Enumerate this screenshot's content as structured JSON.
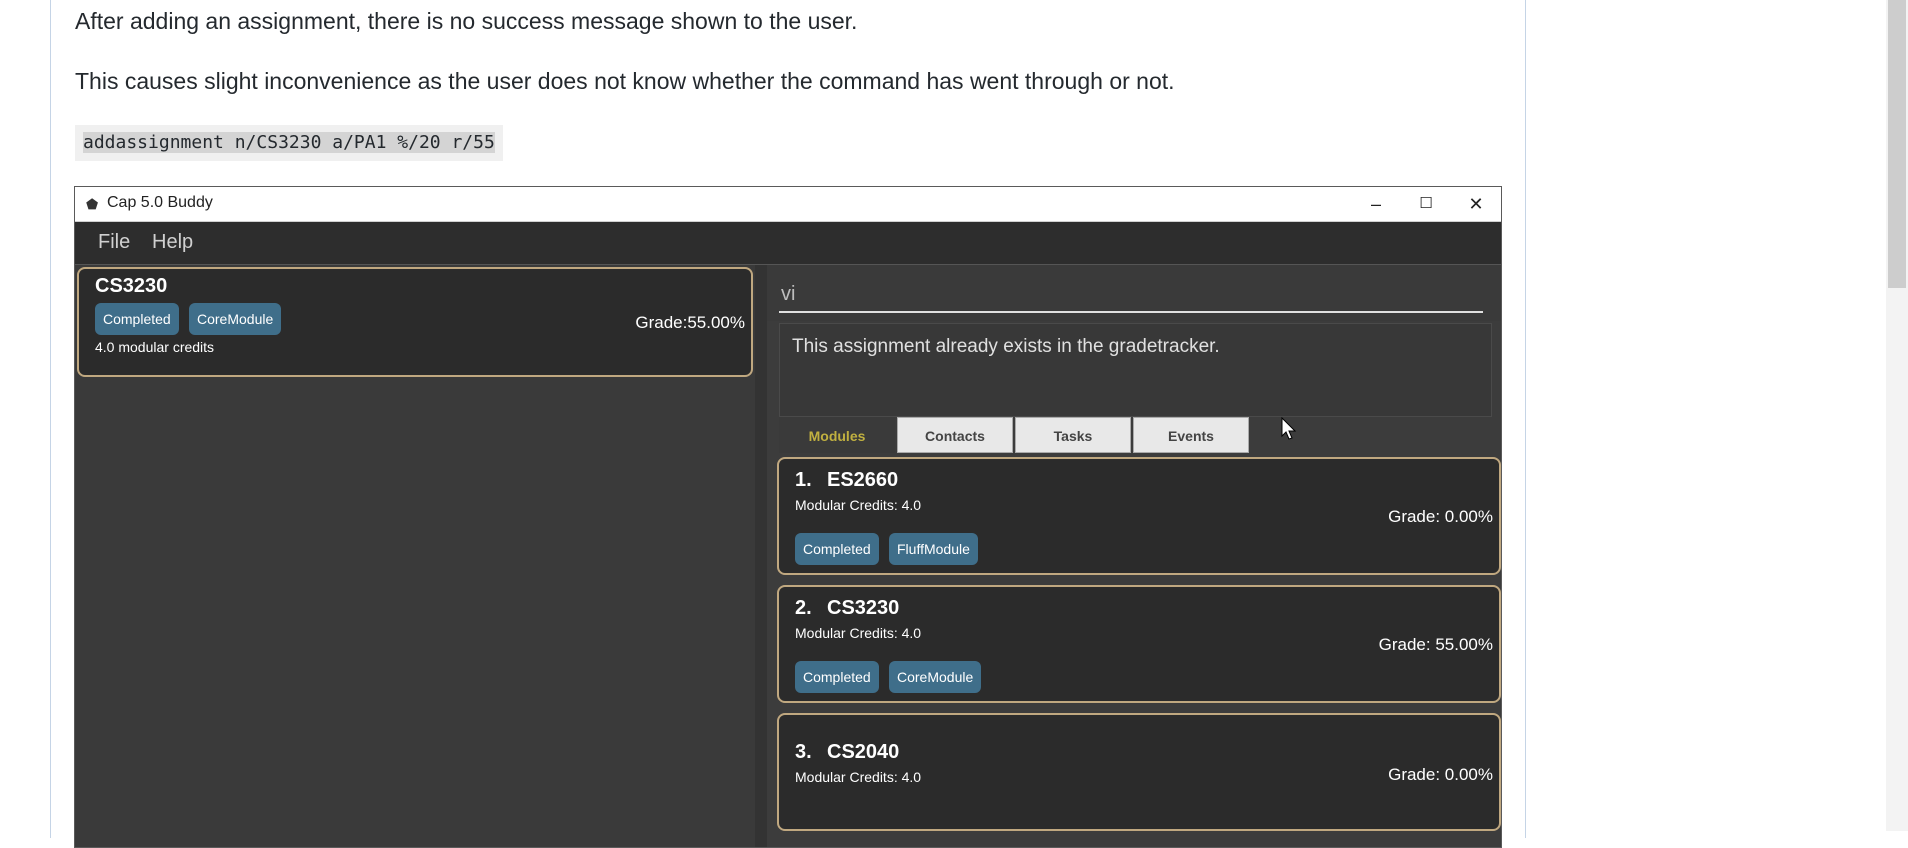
{
  "article": {
    "para1": "After adding an assignment, there is no success message shown to the user.",
    "para2": "This causes slight inconvenience as the user does not know whether the command has went through or not.",
    "code": "addassignment n/CS3230 a/PA1 %/20 r/55"
  },
  "window": {
    "icon": "app-logo-icon",
    "title": "Cap 5.0 Buddy",
    "controls": {
      "minimize": "–",
      "maximize": "☐",
      "close": "✕"
    }
  },
  "menu": {
    "file": "File",
    "help": "Help"
  },
  "selected_module": {
    "code": "CS3230",
    "tags": [
      "Completed",
      "CoreModule"
    ],
    "credits": "4.0 modular credits",
    "grade": "Grade:55.00%"
  },
  "command": {
    "value": "vi"
  },
  "result": {
    "text": "This assignment already exists in the gradetracker."
  },
  "tabs": [
    {
      "label": "Modules",
      "active": true
    },
    {
      "label": "Contacts",
      "active": false
    },
    {
      "label": "Tasks",
      "active": false
    },
    {
      "label": "Events",
      "active": false
    }
  ],
  "modules": [
    {
      "index": "1.",
      "code": "ES2660",
      "credits": "Modular Credits: 4.0",
      "grade": "Grade: 0.00%",
      "tags": [
        "Completed",
        "FluffModule"
      ]
    },
    {
      "index": "2.",
      "code": "CS3230",
      "credits": "Modular Credits: 4.0",
      "grade": "Grade: 55.00%",
      "tags": [
        "Completed",
        "CoreModule"
      ]
    },
    {
      "index": "3.",
      "code": "CS2040",
      "credits": "Modular Credits: 4.0",
      "grade": "Grade: 0.00%",
      "tags": []
    }
  ],
  "colors": {
    "tag": "#3f6e8a",
    "card_border": "#c0a880",
    "active_tab": "#c0b040"
  }
}
